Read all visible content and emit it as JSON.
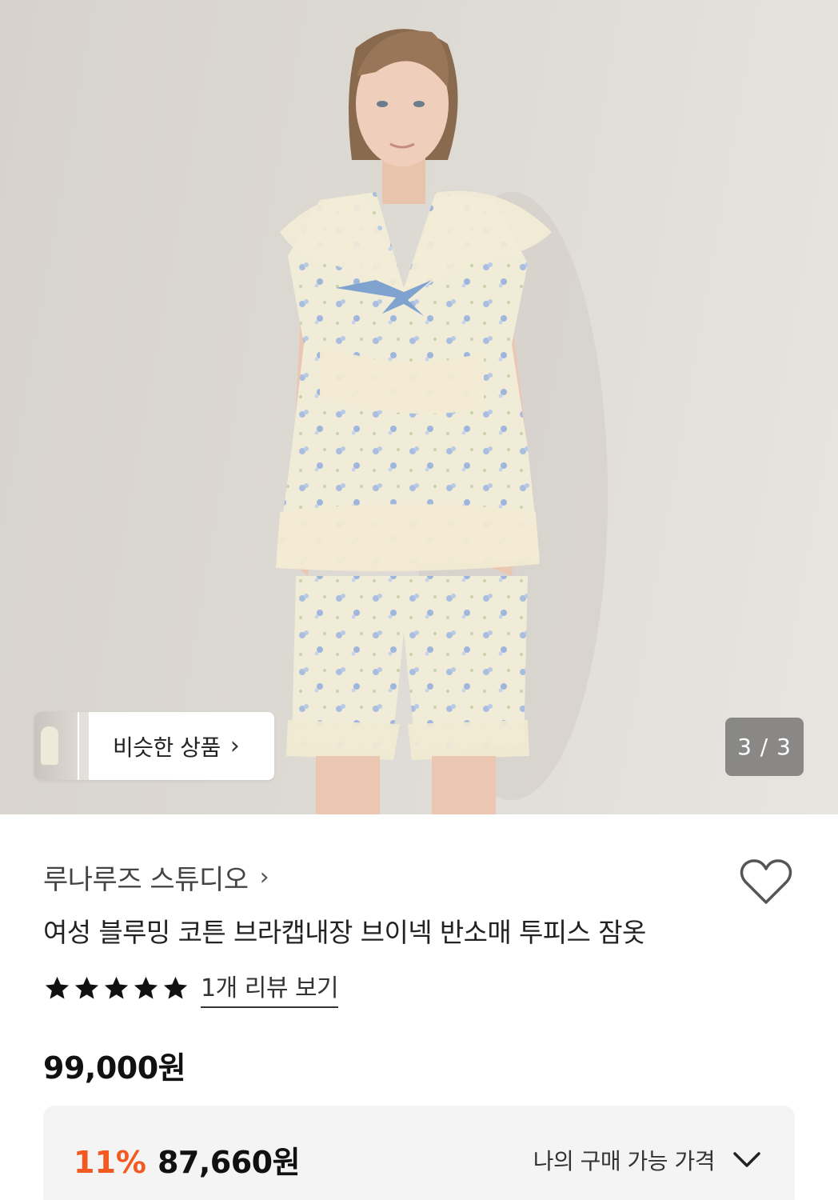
{
  "gallery": {
    "similar_label": "비슷한 상품",
    "page_indicator": "3 / 3",
    "hero_image": "woman-in-floral-lace-pajama-set"
  },
  "product": {
    "brand": "루나루즈 스튜디오",
    "title": "여성 블루밍 코튼 브라캡내장 브이넥 반소매 투피스 잠옷",
    "rating": 5,
    "rating_max": 5,
    "review_link": "1개 리뷰 보기",
    "price_original": "99,000원",
    "discount_rate": "11%",
    "discount_price": "87,660원",
    "my_price_label": "나의 구매 가능 가격"
  },
  "colors": {
    "accent_discount": "#f25a22",
    "text_primary": "#111111",
    "box_bg": "#f4f4f4"
  },
  "icons": {
    "favorite": "heart-outline-icon",
    "expand": "chevron-down-icon",
    "star": "star-filled-icon"
  }
}
